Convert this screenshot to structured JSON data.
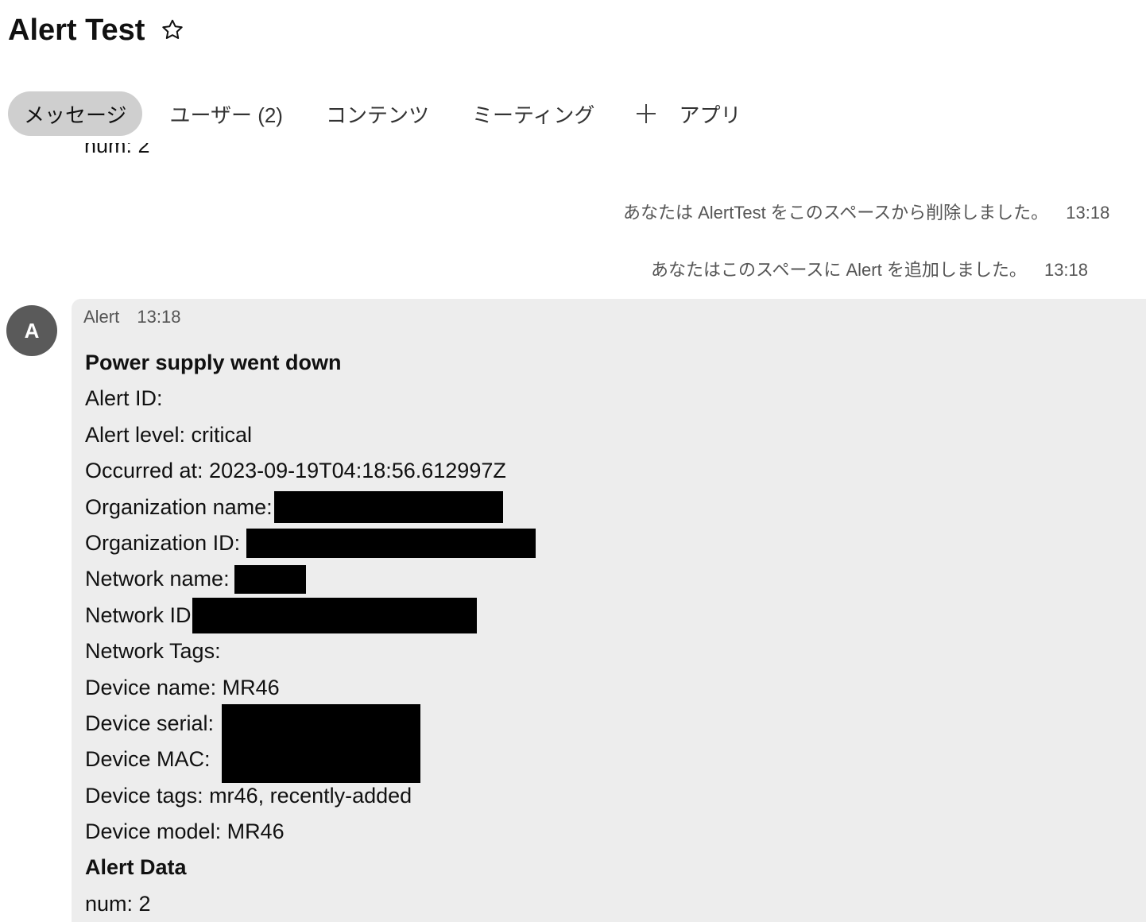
{
  "header": {
    "title": "Alert Test"
  },
  "tabs": [
    {
      "label": "メッセージ",
      "active": true
    },
    {
      "label": "ユーザー (2)",
      "active": false
    },
    {
      "label": "コンテンツ",
      "active": false
    },
    {
      "label": "ミーティング",
      "active": false
    },
    {
      "label": "アプリ",
      "active": false
    }
  ],
  "messages": {
    "clipped_previous": "num: 2",
    "system": [
      {
        "text": "あなたは AlertTest をこのスペースから削除しました。",
        "time": "13:18"
      },
      {
        "text": "あなたはこのスペースに Alert を追加しました。",
        "time": "13:18"
      }
    ],
    "alert": {
      "avatar_initial": "A",
      "sender": "Alert",
      "time": "13:18",
      "heading": "Power supply went down",
      "lines": {
        "alert_id": "Alert ID:",
        "alert_level": "Alert level: critical",
        "occurred_at": "Occurred at: 2023-09-19T04:18:56.612997Z",
        "org_name": "Organization name:",
        "org_id": "Organization ID:",
        "network_name": "Network name:",
        "network_id": "Network ID",
        "network_tags": "Network Tags:",
        "device_name": "Device name: MR46",
        "device_serial": "Device serial:",
        "device_mac": "Device MAC:",
        "device_tags": "Device tags: mr46, recently-added",
        "device_model": "Device model: MR46"
      },
      "data_heading": "Alert Data",
      "data_line": "num: 2"
    }
  },
  "colors": {
    "active_tab": "#cfcfcf",
    "bubble": "#ededed",
    "avatar": "#5a5a5a",
    "redaction": "#000000"
  }
}
